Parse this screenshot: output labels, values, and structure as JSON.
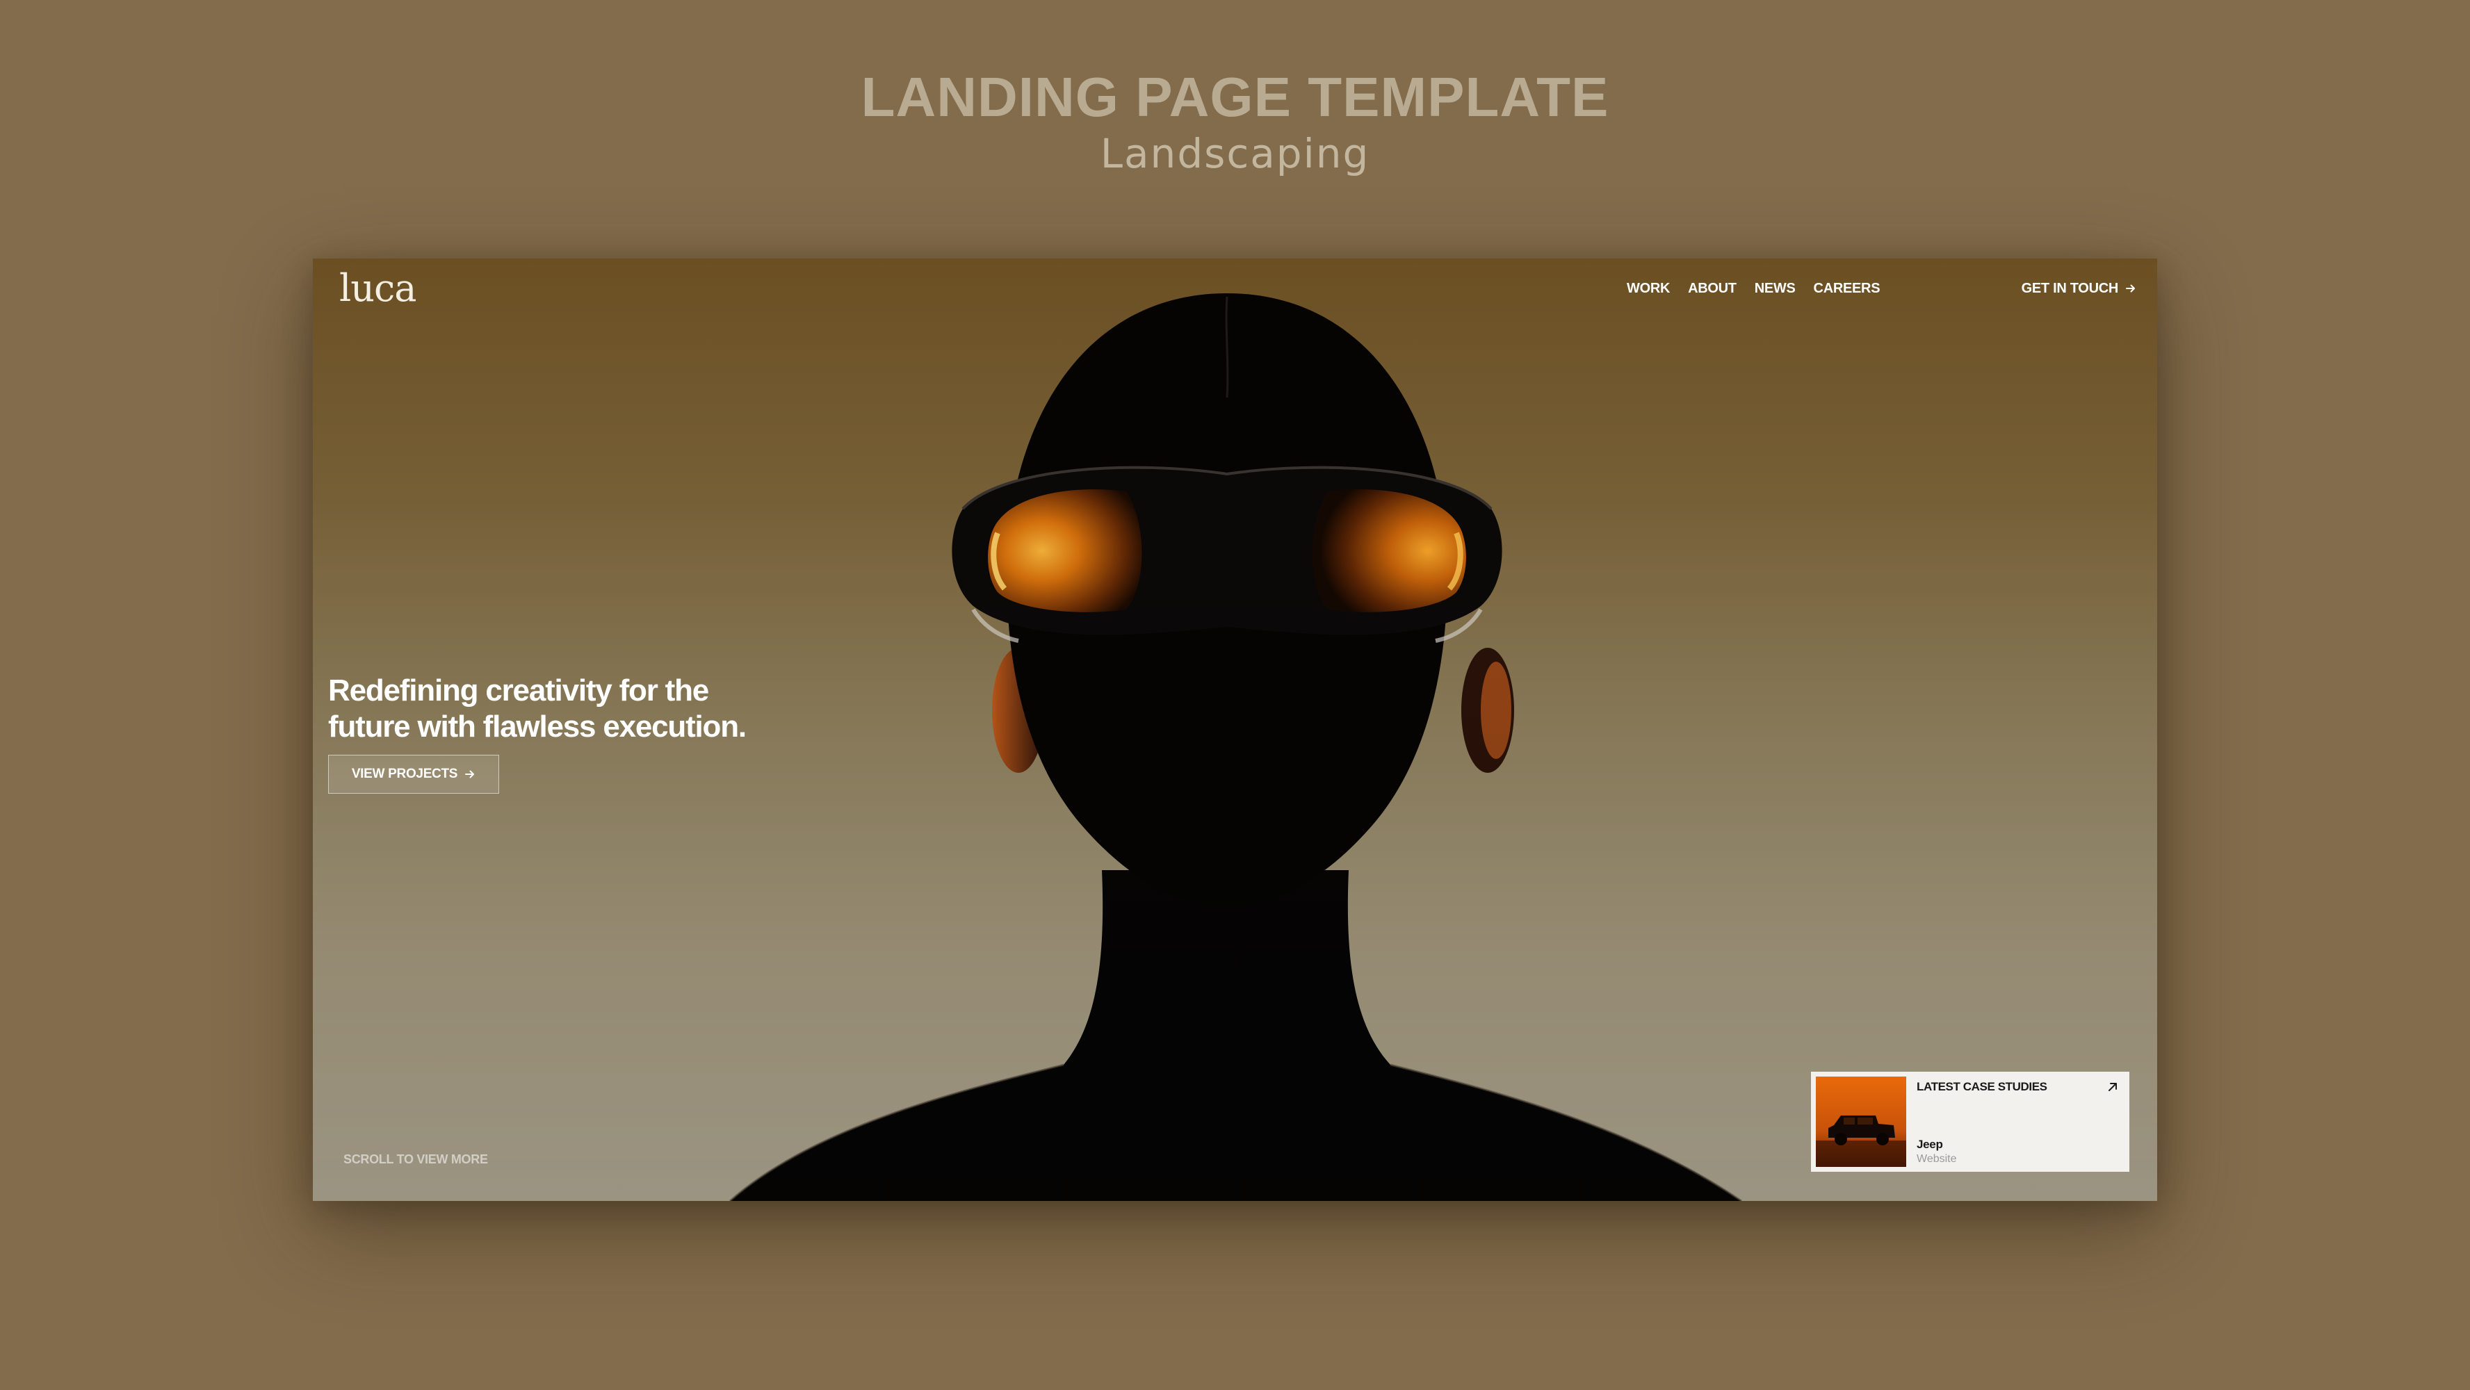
{
  "heading": {
    "title": "LANDING PAGE TEMPLATE",
    "subtitle": "Landscaping"
  },
  "site": {
    "logo": "luca",
    "nav": [
      "WORK",
      "ABOUT",
      "NEWS",
      "CAREERS"
    ],
    "cta_label": "GET IN TOUCH",
    "hero": {
      "headline": "Redefining creativity for the\nfuture with flawless execution.",
      "button_label": "VIEW PROJECTS"
    },
    "scroll_hint": "SCROLL TO VIEW MORE",
    "case_card": {
      "label": "LATEST CASE STUDIES",
      "name": "Jeep",
      "type": "Website"
    }
  },
  "icons": {
    "cta": "arrow-right-icon",
    "button": "arrow-right-icon",
    "card": "arrow-up-right-icon"
  },
  "colors": {
    "outer_background": "#836c4c",
    "lens_orange": "#e0820e",
    "card_background": "#f2f1ee"
  }
}
